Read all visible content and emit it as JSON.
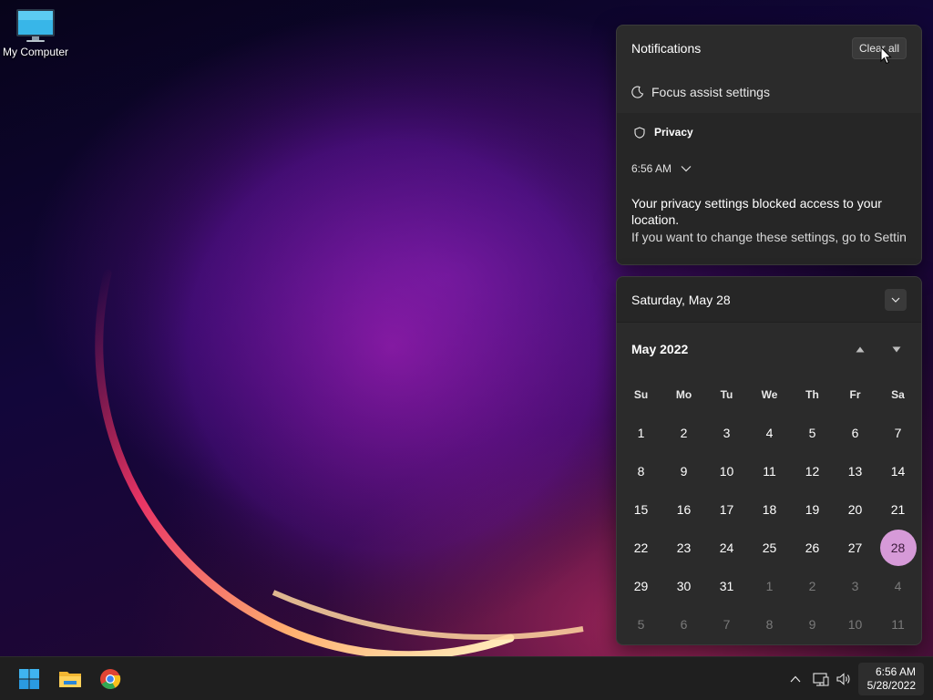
{
  "desktop": {
    "icons": [
      {
        "label": "My Computer",
        "icon": "monitor-icon"
      }
    ]
  },
  "notifications": {
    "title": "Notifications",
    "clear_all_label": "Clear all",
    "focus_assist_label": "Focus assist settings",
    "items": [
      {
        "app": "Privacy",
        "time": "6:56 AM",
        "title": "Your privacy settings blocked access to your location.",
        "body": "If you want to change these settings, go to Settin"
      }
    ]
  },
  "calendar": {
    "full_date": "Saturday, May 28",
    "month_label": "May 2022",
    "weekdays": [
      "Su",
      "Mo",
      "Tu",
      "We",
      "Th",
      "Fr",
      "Sa"
    ],
    "weeks": [
      [
        "1",
        "2",
        "3",
        "4",
        "5",
        "6",
        "7"
      ],
      [
        "8",
        "9",
        "10",
        "11",
        "12",
        "13",
        "14"
      ],
      [
        "15",
        "16",
        "17",
        "18",
        "19",
        "20",
        "21"
      ],
      [
        "22",
        "23",
        "24",
        "25",
        "26",
        "27",
        "28"
      ],
      [
        "29",
        "30",
        "31",
        "1",
        "2",
        "3",
        "4"
      ],
      [
        "5",
        "6",
        "7",
        "8",
        "9",
        "10",
        "11"
      ]
    ],
    "today": "28",
    "accent_color": "#d69ad8"
  },
  "taskbar": {
    "apps": [
      "windows-start-icon",
      "file-explorer-icon",
      "chrome-icon"
    ],
    "tray_icons": [
      "chevron-up-icon",
      "network-icon",
      "volume-icon"
    ],
    "clock_time": "6:56 AM",
    "clock_date": "5/28/2022"
  }
}
